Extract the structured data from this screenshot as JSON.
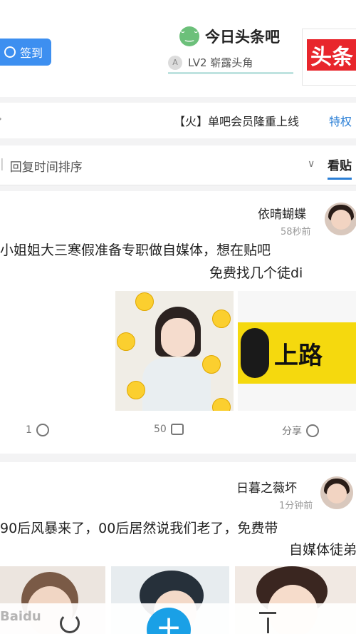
{
  "header": {
    "signin_label": "签到",
    "bar_name": "今日头条吧",
    "level": "LV2 崭露头角",
    "logo_text": "头条"
  },
  "topic_bar": {
    "tag": "特权",
    "topic": "【火】单吧会员隆重上线"
  },
  "tabs": {
    "active_tab": "看贴",
    "sort_label": "回复时间排序"
  },
  "posts": [
    {
      "user": "依晴蝴蝶",
      "time": "58秒前",
      "text_line1": "小姐姐大三寒假准备专职做自媒体，想在贴吧",
      "text_line2": "免费找几个徒di",
      "banner_text": "上路",
      "share_label": "分享",
      "comment_count": "50",
      "like_count": "1"
    },
    {
      "user": "日暮之薇坏",
      "time": "1分钟前",
      "text_line1": "90后风暴来了，00后居然说我们老了，免费带",
      "text_line2": "自媒体徒弟"
    }
  ],
  "watermark": "Baidu"
}
